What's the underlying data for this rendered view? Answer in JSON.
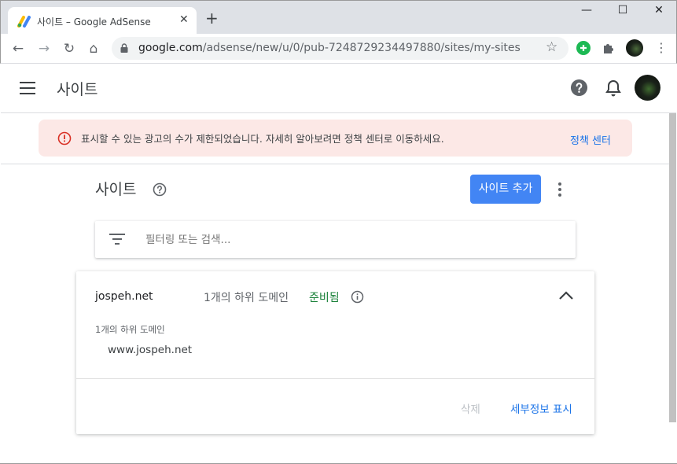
{
  "browser": {
    "tab_title": "사이트 – Google AdSense",
    "tab_close_glyph": "✕",
    "new_tab_glyph": "+",
    "window_controls": {
      "minimize": "—",
      "maximize": "☐",
      "close": "✕"
    },
    "url_host": "google.com",
    "url_path": "/adsense/new/u/0/pub-7248729234497880/sites/my-sites",
    "nav": {
      "back": "←",
      "forward": "→",
      "reload": "↻",
      "home": "⌂"
    },
    "star_glyph": "☆",
    "menu_glyph": "⋮"
  },
  "app": {
    "title": "사이트"
  },
  "banner": {
    "message": "표시할 수 있는 광고의 수가 제한되었습니다. 자세히 알아보려면 정책 센터로 이동하세요.",
    "link_label": "정책 센터"
  },
  "sites": {
    "title": "사이트",
    "add_button_label": "사이트 추가",
    "filter_placeholder": "필터링 또는 검색..."
  },
  "site_card": {
    "name": "jospeh.net",
    "subdomain_count": "1개의 하위 도메인",
    "status": "준비됨",
    "subdomain_label": "1개의 하위 도메인",
    "subdomain": "www.jospeh.net",
    "delete_label": "삭제",
    "details_label": "세부정보 표시"
  },
  "colors": {
    "primary_blue": "#4285f4",
    "link_blue": "#1a73e8",
    "status_green": "#188038",
    "banner_bg": "#fce8e6",
    "error_red": "#d93025"
  }
}
